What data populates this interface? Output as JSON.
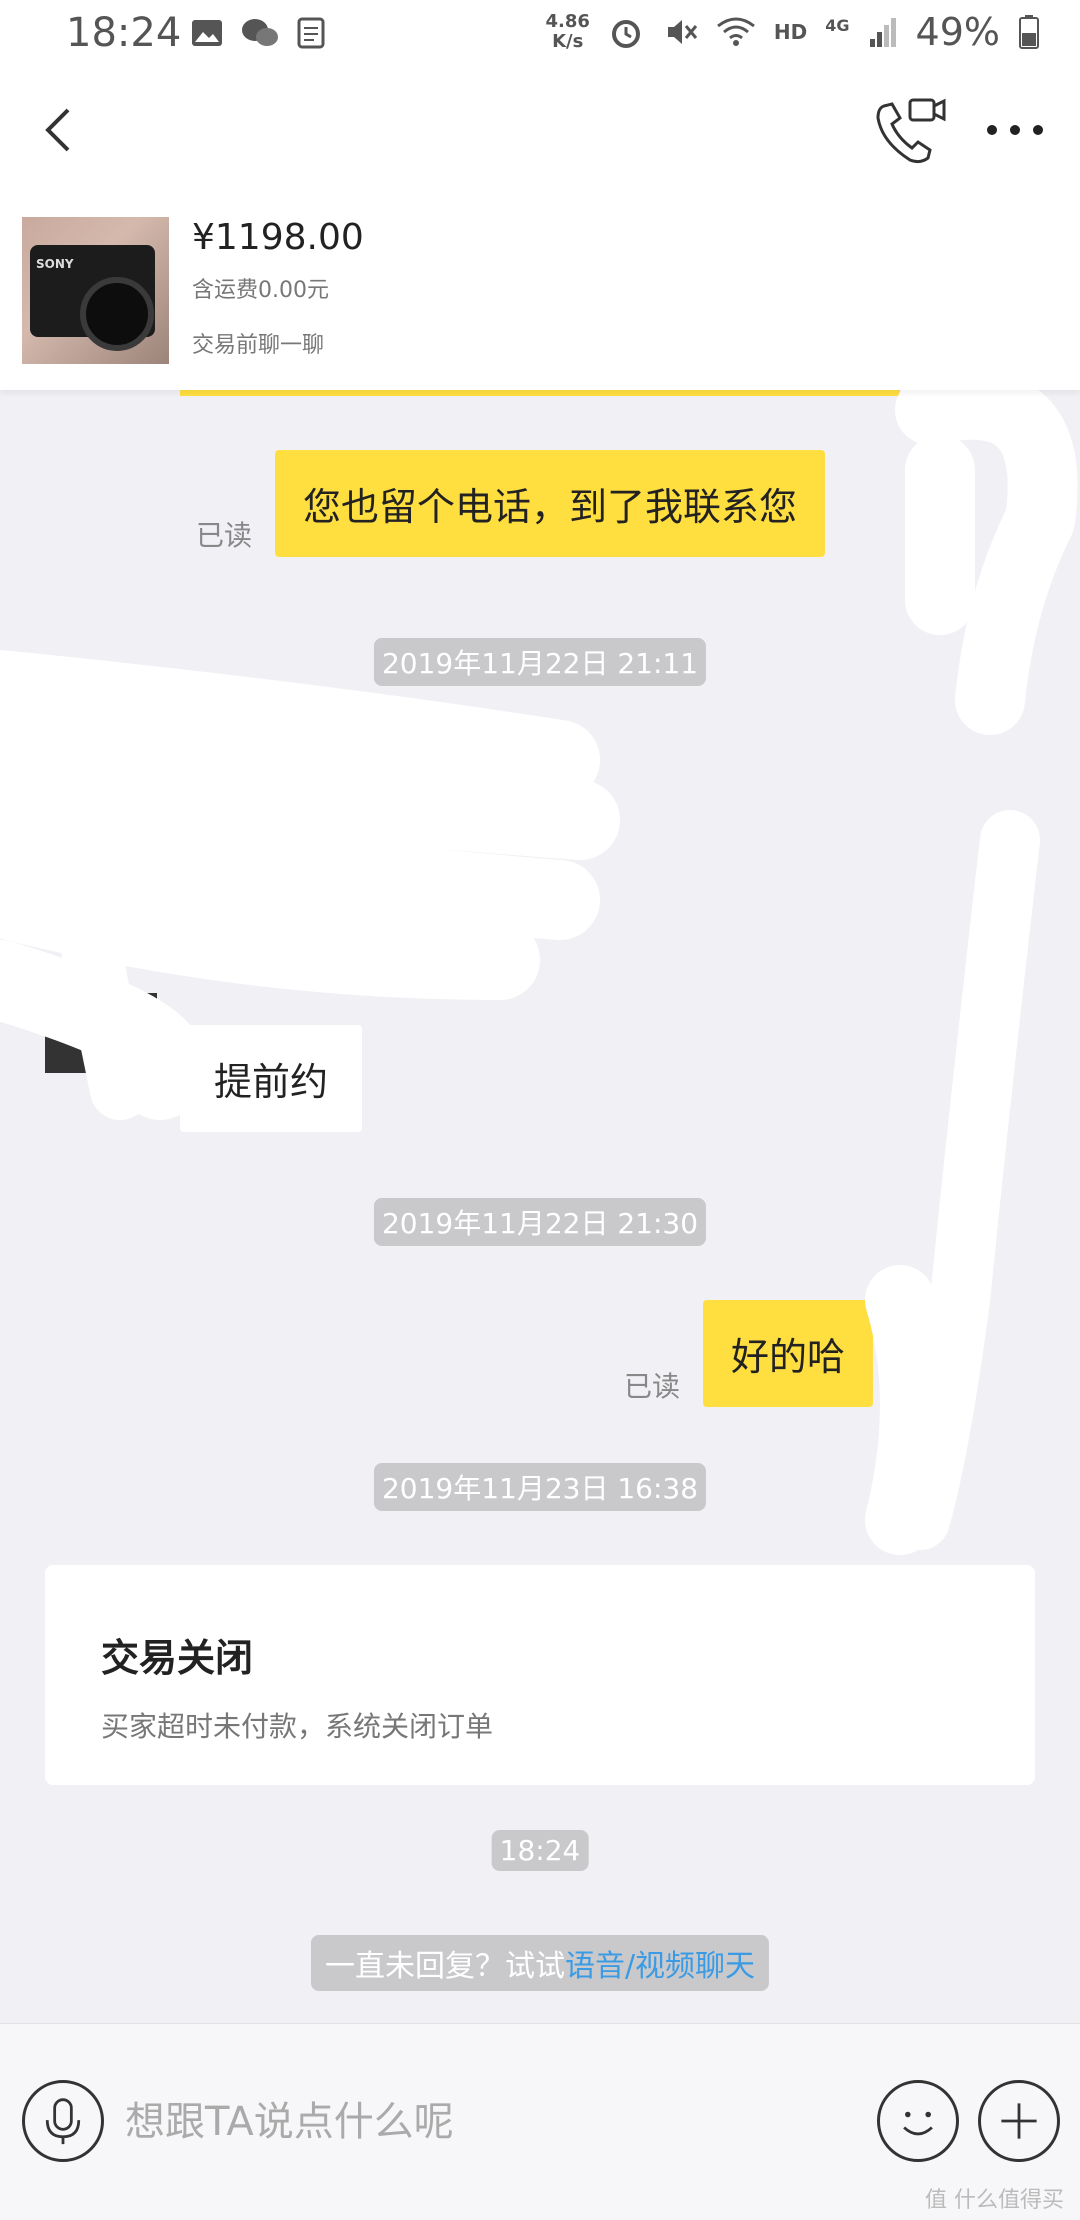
{
  "status_bar": {
    "time": "18:24",
    "speed_value": "4.86",
    "speed_unit": "K/s",
    "network": "HD",
    "signal": "4G",
    "battery": "49%"
  },
  "nav": {
    "back_icon": "chevron-left-icon",
    "call_icon": "phone-video-icon",
    "more_icon": "more-horizontal-icon"
  },
  "product": {
    "price": "¥1198.00",
    "shipping": "含运费0.00元",
    "hint": "交易前聊一聊",
    "thumb_brand": "SONY"
  },
  "messages": {
    "m1": {
      "text": "您也留个电话，到了我联系您",
      "read": "已读"
    },
    "t1": "2019年11月22日 21:11",
    "m2": {
      "text": "提前约"
    },
    "t2": "2019年11月22日 21:30",
    "m3": {
      "text": "好的哈",
      "read": "已读"
    },
    "t3": "2019年11月23日 16:38",
    "t4": "18:24"
  },
  "card": {
    "title": "交易关闭",
    "subtitle": "买家超时未付款，系统关闭订单"
  },
  "hint": {
    "prefix": "一直未回复？试试",
    "link": "语音/视频聊天"
  },
  "input_bar": {
    "placeholder": "想跟TA说点什么呢",
    "voice_icon": "microphone-icon",
    "emoji_icon": "smiley-icon",
    "plus_icon": "plus-icon"
  },
  "watermark": "值 什么值得买",
  "colors": {
    "bubble_mine": "#ffde3f",
    "bubble_other": "#ffffff",
    "link": "#3a9be4",
    "background": "#f1f1f5"
  }
}
